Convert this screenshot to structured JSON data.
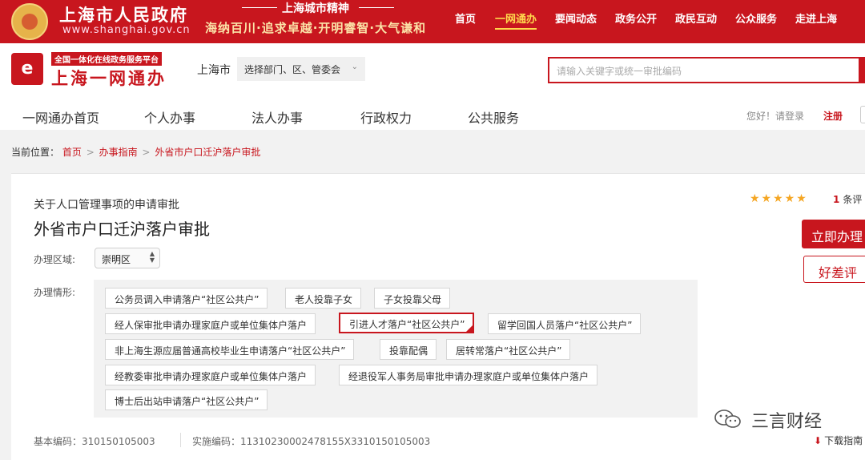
{
  "gov_bar": {
    "title": "上海市人民政府",
    "url": "www.shanghai.gov.cn",
    "spirit_title": "上海城市精神",
    "spirit_text": "海纳百川·追求卓越·开明睿智·大气谦和",
    "nav": [
      "首页",
      "一网通办",
      "要闻动态",
      "政务公开",
      "政民互动",
      "公众服务",
      "走进上海"
    ]
  },
  "portal": {
    "logo_char": "e",
    "tagline": "全国一体化在线政务服务平台",
    "name": "上海一网通办",
    "region": "上海市",
    "dept_select": "选择部门、区、管委会",
    "search_placeholder": "请输入关键字或统一审批编码",
    "nav": [
      "一网通办首页",
      "个人办事",
      "法人办事",
      "行政权力",
      "公共服务"
    ],
    "login_text": "您好！请登录",
    "register": "注册"
  },
  "breadcrumb": {
    "label": "当前位置：",
    "items": [
      "首页",
      "办事指南",
      "外省市户口迁沪落户审批"
    ]
  },
  "item": {
    "category": "关于人口管理事项的申请审批",
    "title": "外省市户口迁沪落户审批",
    "district_label": "办理区域:",
    "district_value": "崇明区",
    "case_label": "办理情形:",
    "cases": [
      "公务员调入申请落户“社区公共户”",
      "老人投靠子女",
      "子女投靠父母",
      "经人保审批申请办理家庭户或单位集体户落户",
      "引进人才落户“社区公共户”",
      "留学回国人员落户“社区公共户”",
      "非上海生源应届普通高校毕业生申请落户“社区公共户”",
      "投靠配偶",
      "居转常落户“社区公共户”",
      "经教委审批申请办理家庭户或单位集体户落户",
      "经退役军人事务局审批申请办理家庭户或单位集体户落户",
      "博士后出站申请落户“社区公共户”"
    ],
    "selected_case": "引进人才落户“社区公共户”",
    "basic_code_label": "基本编码：",
    "basic_code": "310150105003",
    "impl_code_label": "实施编码：",
    "impl_code": "11310230002478155X3310150105003"
  },
  "side": {
    "stars": "★★★★★",
    "rating_stars": 5,
    "review_num": "1",
    "review_text": "条评",
    "apply": "立即办理",
    "rate": "好差评",
    "download": "下载指南"
  },
  "watermark": "三言财经",
  "colors": {
    "brand_red": "#c8161e",
    "star": "#f5a623",
    "panel_bg": "#f2f2f2"
  }
}
